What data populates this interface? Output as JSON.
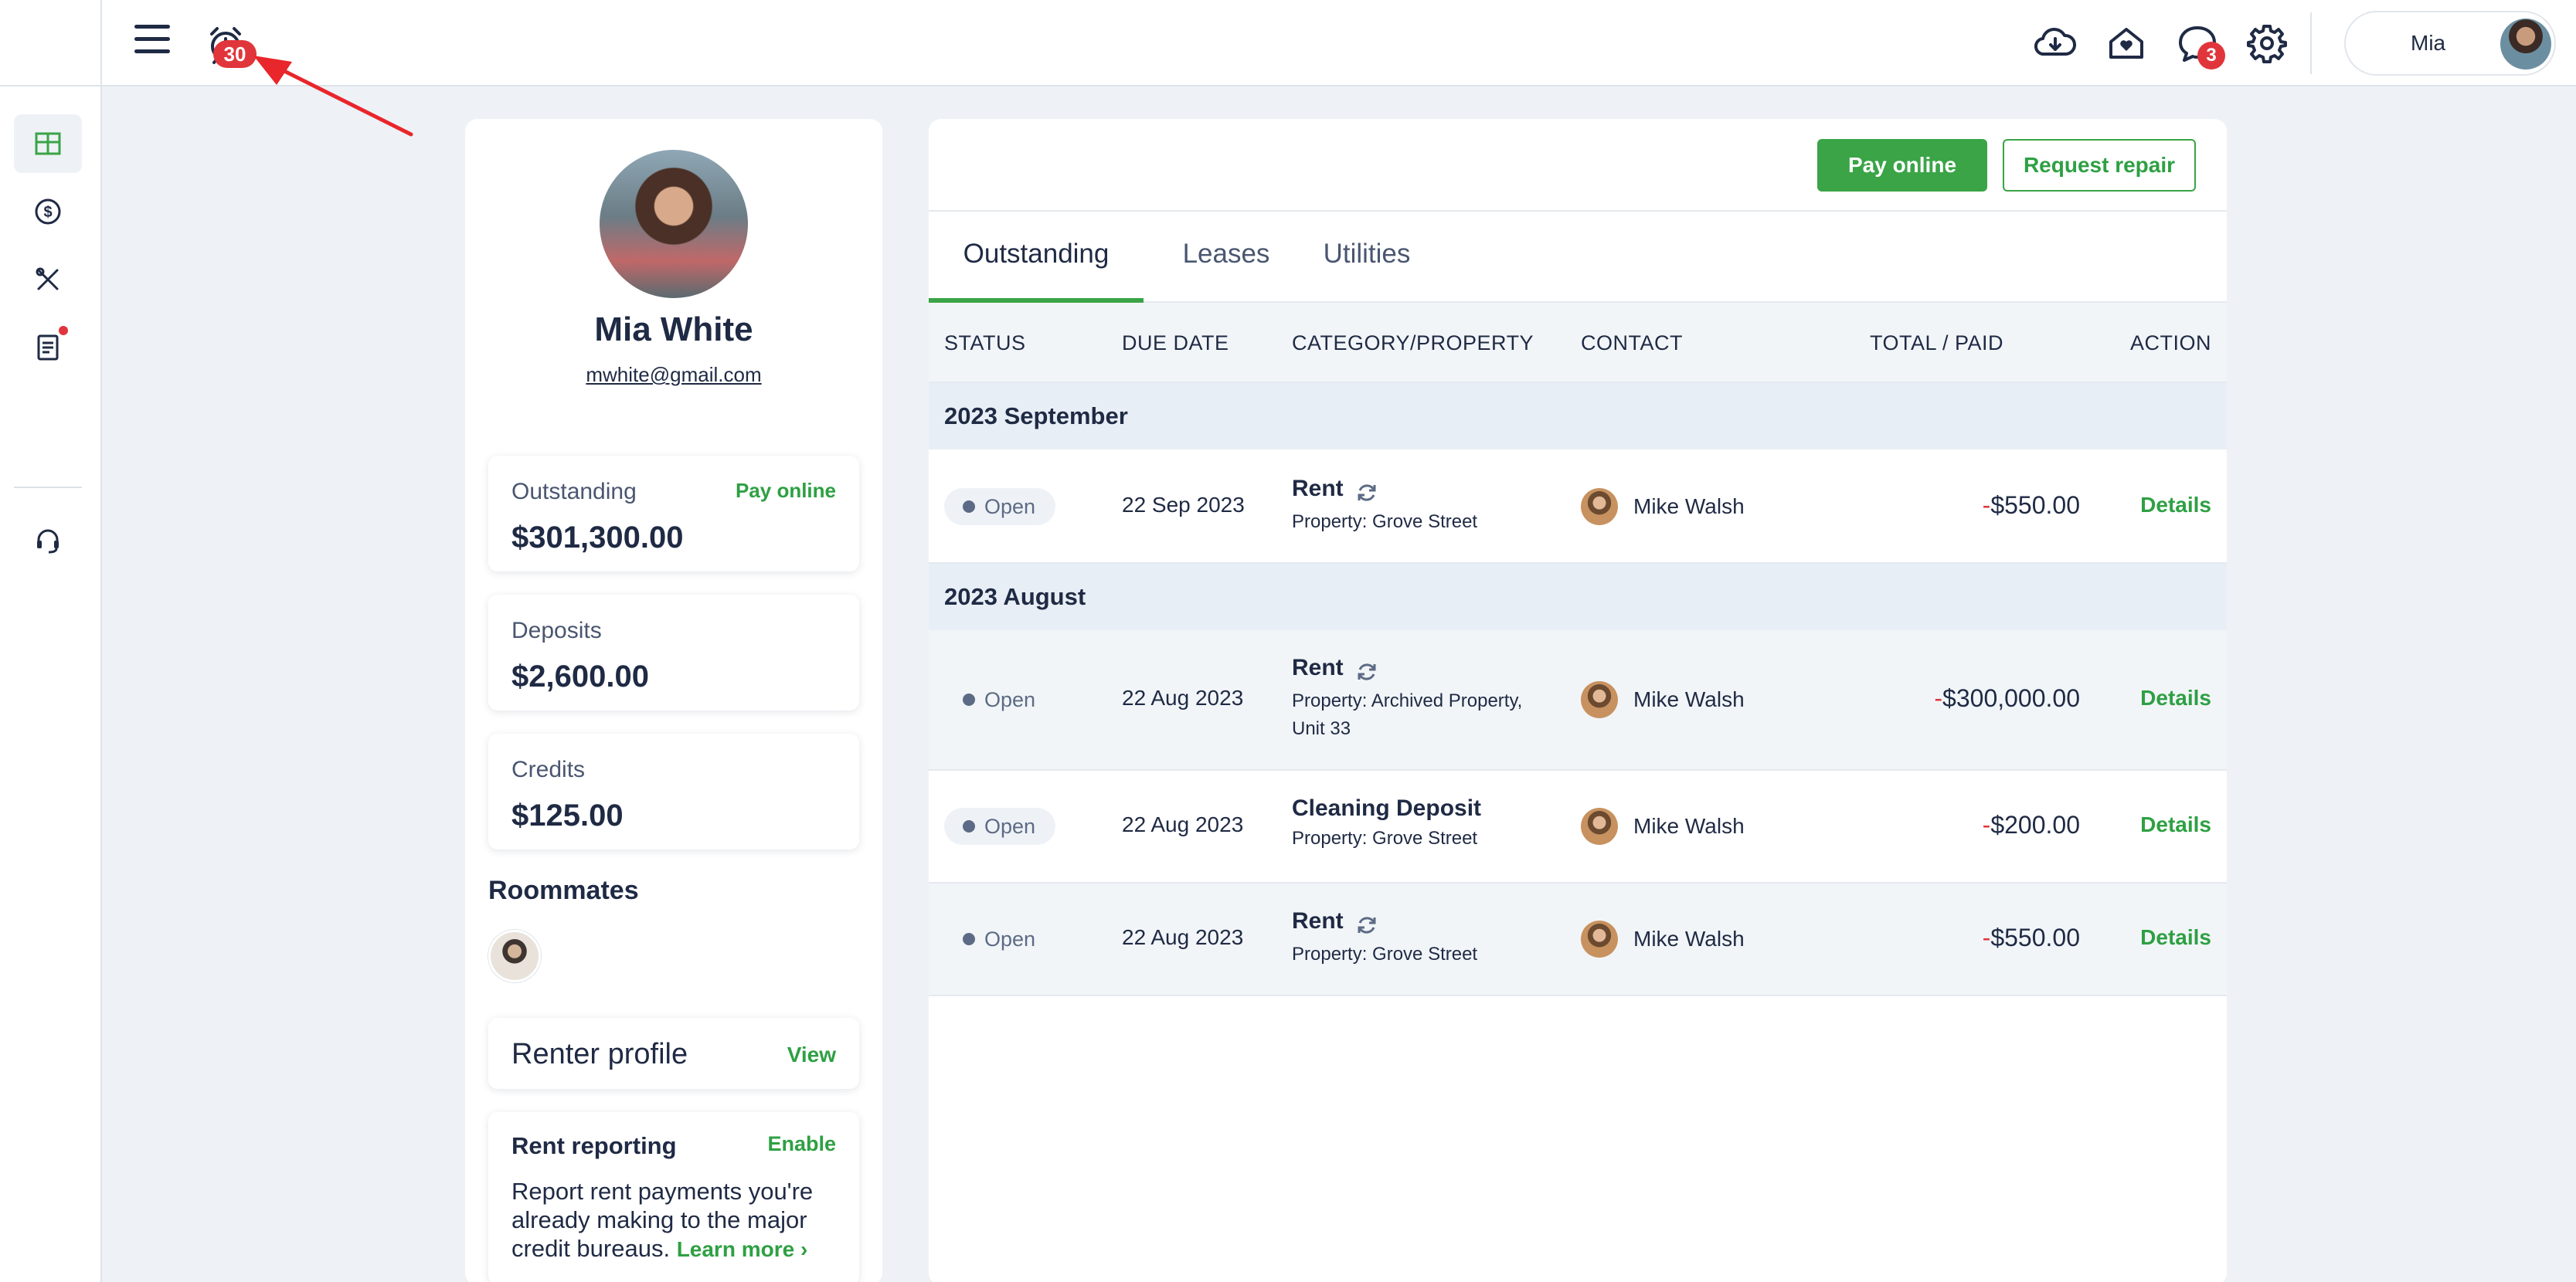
{
  "topbar": {
    "alarm_count": "30",
    "chat_count": "3",
    "user_name": "Mia",
    "icons": [
      "hamburger-menu-icon",
      "alarm-clock-icon",
      "cloud-download-icon",
      "home-heart-icon",
      "chat-icon",
      "gear-icon"
    ]
  },
  "sidebar": {
    "items": [
      {
        "icon": "dashboard-icon",
        "active": true
      },
      {
        "icon": "dollar-circle-icon",
        "active": false
      },
      {
        "icon": "tools-icon",
        "active": false
      },
      {
        "icon": "document-icon",
        "active": false,
        "has_notification": true
      },
      {
        "icon": "headset-icon",
        "active": false
      }
    ]
  },
  "profile": {
    "name": "Mia White",
    "email": "mwhite@gmail.com",
    "outstanding": {
      "label": "Outstanding",
      "value": "$301,300.00",
      "link": "Pay online"
    },
    "deposits": {
      "label": "Deposits",
      "value": "$2,600.00"
    },
    "credits": {
      "label": "Credits",
      "value": "$125.00"
    },
    "roommates_title": "Roommates",
    "renter_profile": {
      "title": "Renter profile",
      "link": "View"
    },
    "rent_reporting": {
      "title": "Rent reporting",
      "link": "Enable",
      "text": "Report rent payments you're already making to the major credit bureaus.",
      "learn_more": "Learn more"
    }
  },
  "actions": {
    "pay_online": "Pay online",
    "request_repair": "Request repair"
  },
  "tabs": [
    {
      "label": "Outstanding",
      "active": true
    },
    {
      "label": "Leases",
      "active": false
    },
    {
      "label": "Utilities",
      "active": false
    }
  ],
  "table": {
    "headers": {
      "status": "STATUS",
      "due_date": "DUE DATE",
      "category": "CATEGORY/PROPERTY",
      "contact": "CONTACT",
      "total": "TOTAL / PAID",
      "action": "ACTION"
    },
    "groups": [
      {
        "label": "2023 September",
        "rows": [
          {
            "status": "Open",
            "due": "22 Sep 2023",
            "category": "Rent",
            "recurring": true,
            "property": "Property: Grove Street",
            "contact": "Mike Walsh",
            "sign": "-",
            "amount": "$550.00",
            "action": "Details"
          }
        ]
      },
      {
        "label": "2023 August",
        "rows": [
          {
            "status": "Open",
            "due": "22 Aug 2023",
            "category": "Rent",
            "recurring": true,
            "property": "Property: Archived Property, Unit 33",
            "contact": "Mike Walsh",
            "sign": "-",
            "amount": "$300,000.00",
            "action": "Details"
          },
          {
            "status": "Open",
            "due": "22 Aug 2023",
            "category": "Cleaning Deposit",
            "recurring": false,
            "property": "Property: Grove Street",
            "contact": "Mike Walsh",
            "sign": "-",
            "amount": "$200.00",
            "action": "Details"
          },
          {
            "status": "Open",
            "due": "22 Aug 2023",
            "category": "Rent",
            "recurring": true,
            "property": "Property: Grove Street",
            "contact": "Mike Walsh",
            "sign": "-",
            "amount": "$550.00",
            "action": "Details"
          }
        ]
      }
    ]
  },
  "colors": {
    "accent_green": "#3aa447",
    "badge_red": "#e0363b",
    "text_navy": "#1f2a44",
    "page_bg": "#eef2f6"
  }
}
